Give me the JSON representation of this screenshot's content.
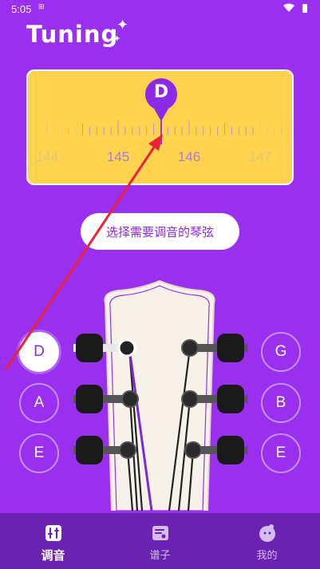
{
  "status_bar": {
    "time": "5:05",
    "extra": "⊞"
  },
  "app": {
    "title": "Tuning"
  },
  "tuner": {
    "note": "D",
    "scale_labels": [
      "144",
      "145",
      "146",
      "147"
    ]
  },
  "select_button": {
    "label": "选择需要调音的琴弦"
  },
  "strings": {
    "left": [
      "D",
      "A",
      "E"
    ],
    "right": [
      "G",
      "B",
      "E"
    ],
    "selected": "D"
  },
  "bottom_nav": {
    "items": [
      {
        "label": "调音",
        "icon": "tuner-icon"
      },
      {
        "label": "谱子",
        "icon": "sheet-icon"
      },
      {
        "label": "我的",
        "icon": "profile-icon"
      }
    ],
    "active_index": 0
  },
  "colors": {
    "background": "#9A2FF0",
    "card": "#FFD34D",
    "accent": "#8B2AE6",
    "nav": "#6A22B0",
    "annotation": "#E8233A"
  }
}
